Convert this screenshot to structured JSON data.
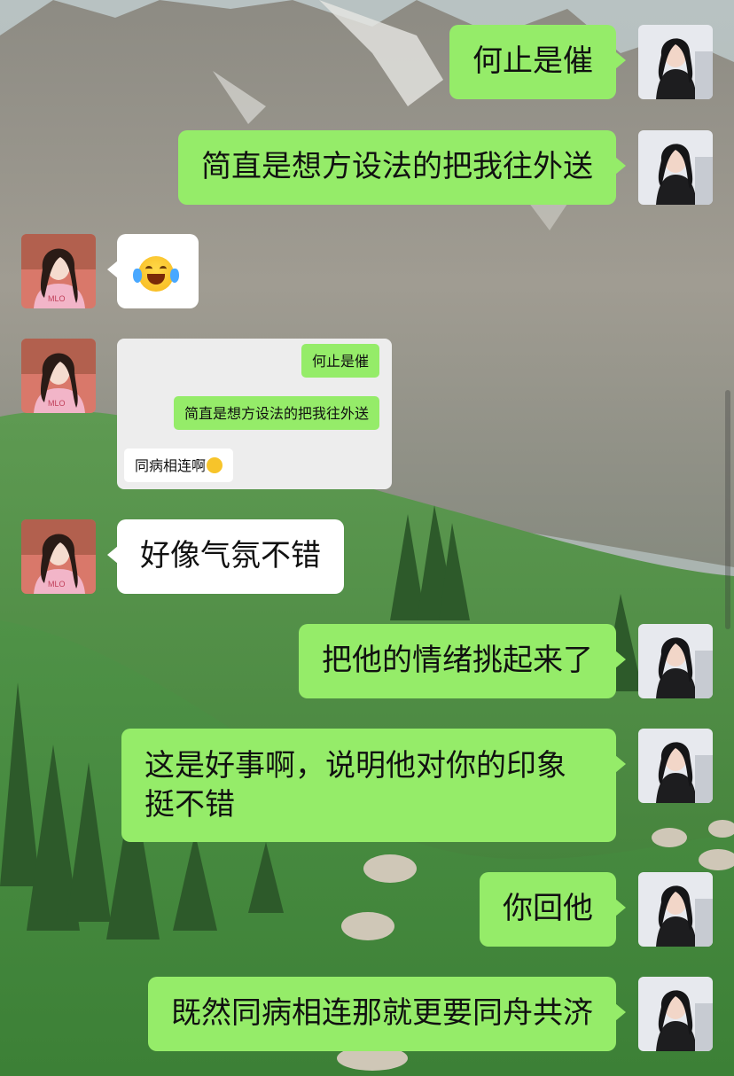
{
  "messages": [
    {
      "side": "right",
      "text": "何止是催"
    },
    {
      "side": "right",
      "text": "简直是想方设法的把我往外送"
    },
    {
      "side": "left",
      "type": "emoji",
      "emoji": "laughing-tears-emoji"
    },
    {
      "side": "left",
      "type": "image",
      "quoted": {
        "line1": "何止是催",
        "line2": "简直是想方设法的把我往外送",
        "line3": "同病相连啊"
      }
    },
    {
      "side": "left",
      "text": "好像气氛不错"
    },
    {
      "side": "right",
      "text": "把他的情绪挑起来了"
    },
    {
      "side": "right",
      "text": "这是好事啊，说明他对你的印象挺不错"
    },
    {
      "side": "right",
      "text": "你回他"
    },
    {
      "side": "right",
      "text": "既然同病相连那就更要同舟共济"
    }
  ],
  "colors": {
    "bubble_green": "#95ec69",
    "bubble_white": "#ffffff"
  }
}
